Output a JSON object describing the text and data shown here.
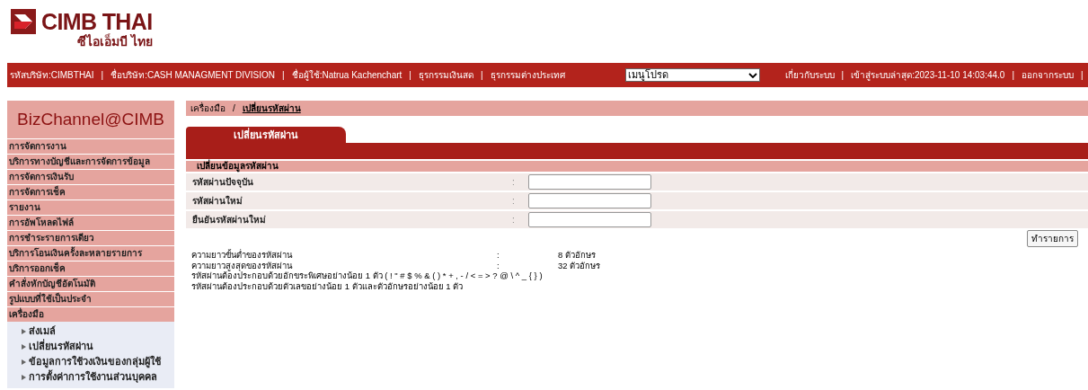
{
  "logo": {
    "name": "CIMB THAI",
    "subtitle": "ซีไอเอ็มบี ไทย"
  },
  "header_bar": {
    "items": [
      {
        "kind": "text",
        "text": "รหัสบริษัท:CIMBTHAI"
      },
      {
        "kind": "separator",
        "text": "|"
      },
      {
        "kind": "text",
        "text": "ชื่อบริษัท:CASH MANAGMENT DIVISION"
      },
      {
        "kind": "separator",
        "text": "|"
      },
      {
        "kind": "text",
        "text": "ชื่อผู้ใช้:Natrua Kachenchart"
      },
      {
        "kind": "separator",
        "text": "|"
      },
      {
        "kind": "link",
        "text": "ธุรกรรมเงินสด"
      },
      {
        "kind": "separator",
        "text": "|"
      },
      {
        "kind": "link",
        "text": "ธุรกรรมต่างประเทศ"
      },
      {
        "kind": "select",
        "text": "เมนูโปรด"
      },
      {
        "kind": "link",
        "text": "เกี่ยวกับระบบ"
      },
      {
        "kind": "separator",
        "text": "|"
      },
      {
        "kind": "text",
        "text": "เข้าสู่ระบบล่าสุด:2023-11-10 14:03:44.0"
      },
      {
        "kind": "separator",
        "text": "|"
      },
      {
        "kind": "link",
        "text": "ออกจากระบบ"
      },
      {
        "kind": "separator",
        "text": "|"
      }
    ]
  },
  "sidebar": {
    "title": "BizChannel@CIMB",
    "items": [
      {
        "label": "การจัดการงาน"
      },
      {
        "label": "บริการทางบัญชีและการจัดการข้อมูล"
      },
      {
        "label": "การจัดการเงินรับ"
      },
      {
        "label": "การจัดการเช็ค"
      },
      {
        "label": "รายงาน"
      },
      {
        "label": "การอัพโหลดไฟล์"
      },
      {
        "label": "การชำระรายการเดียว"
      },
      {
        "label": "บริการโอนเงินครั้งละหลายรายการ"
      },
      {
        "label": "บริการออกเช็ค"
      },
      {
        "label": "คำสั่งหักบัญชีอัตโนมัติ"
      },
      {
        "label": "รูปแบบที่ใช้เป็นประจำ"
      },
      {
        "label": "เครื่องมือ",
        "children": [
          {
            "label": "ส่งเมล์"
          },
          {
            "label": "เปลี่ยนรหัสผ่าน"
          },
          {
            "label": "ข้อมูลการใช้วงเงินของกลุ่มผู้ใช้"
          },
          {
            "label": "การตั้งค่าการใช้งานส่วนบุคคล"
          }
        ]
      }
    ]
  },
  "breadcrumb": [
    {
      "label": "เครื่องมือ",
      "current": false
    },
    {
      "label": "เปลี่ยนรหัสผ่าน",
      "current": true
    }
  ],
  "breadcrumb_separator": "/",
  "form": {
    "tab": "เปลี่ยนรหัสผ่าน",
    "section": "เปลี่ยนข้อมูลรหัสผ่าน",
    "fields": [
      {
        "label": "รหัสผ่านปัจจุบัน",
        "colon": ":"
      },
      {
        "label": "รหัสผ่านใหม่",
        "colon": ":"
      },
      {
        "label": "ยืนยันรหัสผ่านใหม่",
        "colon": ":"
      }
    ],
    "submit": "ทำรายการ"
  },
  "rules": [
    {
      "label": "ความยาวขั้นต่ำของรหัสผ่าน",
      "colon": ":",
      "value": "8 ตัวอักษร"
    },
    {
      "label": "ความยาวสูงสุดของรหัสผ่าน",
      "colon": ":",
      "value": "32 ตัวอักษร"
    },
    {
      "label": "รหัสผ่านต้องประกอบด้วยอักขระพิเศษอย่างน้อย 1 ตัว ( ! \" # $ % & ( ) * + , - / < = > ? @ \\ ^ _ { } )"
    },
    {
      "label": "รหัสผ่านต้องประกอบด้วยตัวเลขอย่างน้อย 1 ตัวและตัวอักษรอย่างน้อย 1 ตัว"
    }
  ]
}
